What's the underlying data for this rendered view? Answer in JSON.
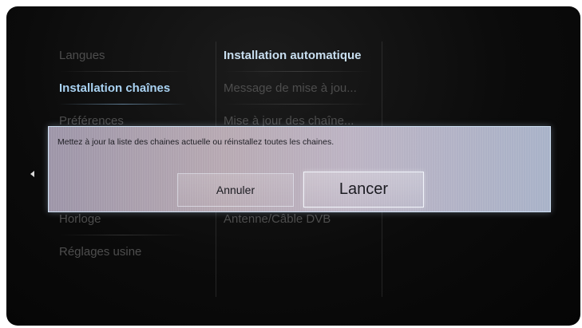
{
  "menu_left": {
    "items": [
      {
        "label": "Langues",
        "state": "normal"
      },
      {
        "label": "Installation chaînes",
        "state": "selected"
      },
      {
        "label": "Préférences",
        "state": "normal"
      },
      {
        "label": "",
        "state": "hidden"
      },
      {
        "label": "",
        "state": "hidden"
      },
      {
        "label": "Horloge",
        "state": "normal"
      },
      {
        "label": "Réglages usine",
        "state": "normal"
      }
    ]
  },
  "menu_mid": {
    "items": [
      {
        "label": "Installation automatique",
        "state": "title"
      },
      {
        "label": "Message de mise à jou...",
        "state": "normal"
      },
      {
        "label": "Mise à jour des chaîne...",
        "state": "normal"
      },
      {
        "label": "",
        "state": "hidden"
      },
      {
        "label": "",
        "state": "hidden"
      },
      {
        "label": "Antenne/Câble DVB",
        "state": "normal"
      }
    ]
  },
  "dialog": {
    "message": "Mettez à jour la liste des chaines actuelle ou réinstallez toutes les chaines.",
    "cancel_label": "Annuler",
    "start_label": "Lancer"
  },
  "icons": {
    "back": "chevron-left-icon"
  },
  "colors": {
    "selected_text": "#a9d2f2",
    "dim_text": "#4d4d4d",
    "dialog_border": "#d2e6fa"
  }
}
